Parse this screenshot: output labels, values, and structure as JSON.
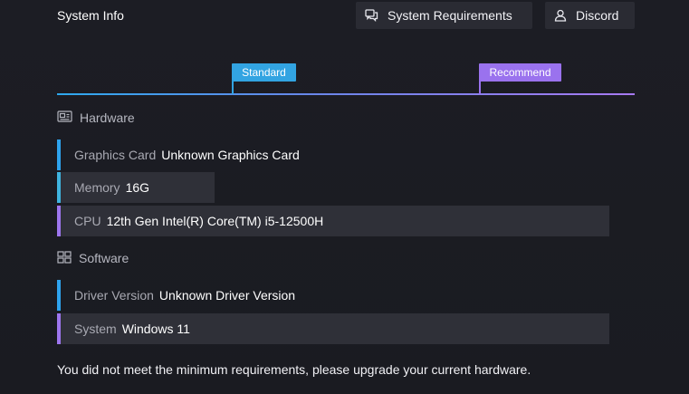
{
  "header": {
    "title": "System Info",
    "requirements_label": "System Requirements",
    "discord_label": "Discord"
  },
  "scale": {
    "standard_label": "Standard",
    "recommend_label": "Recommend"
  },
  "hardware": {
    "heading": "Hardware",
    "rows": [
      {
        "label": "Graphics Card",
        "value": "Unknown Graphics Card"
      },
      {
        "label": "Memory",
        "value": "16G"
      },
      {
        "label": "CPU",
        "value": "12th Gen Intel(R) Core(TM) i5-12500H"
      }
    ]
  },
  "software": {
    "heading": "Software",
    "rows": [
      {
        "label": "Driver Version",
        "value": "Unknown Driver Version"
      },
      {
        "label": "System",
        "value": "Windows 11"
      }
    ]
  },
  "notice": "You did not meet the minimum requirements, please upgrade your current hardware.",
  "colors": {
    "standard": "#32a4e2",
    "recommend": "#9a72ee",
    "background": "#1a1b21",
    "row_fill": "#2f3038"
  },
  "icons": {
    "requirements": "chat-bubbles-icon",
    "discord": "user-icon",
    "hardware": "hardware-card-icon",
    "software": "windows-grid-icon"
  }
}
